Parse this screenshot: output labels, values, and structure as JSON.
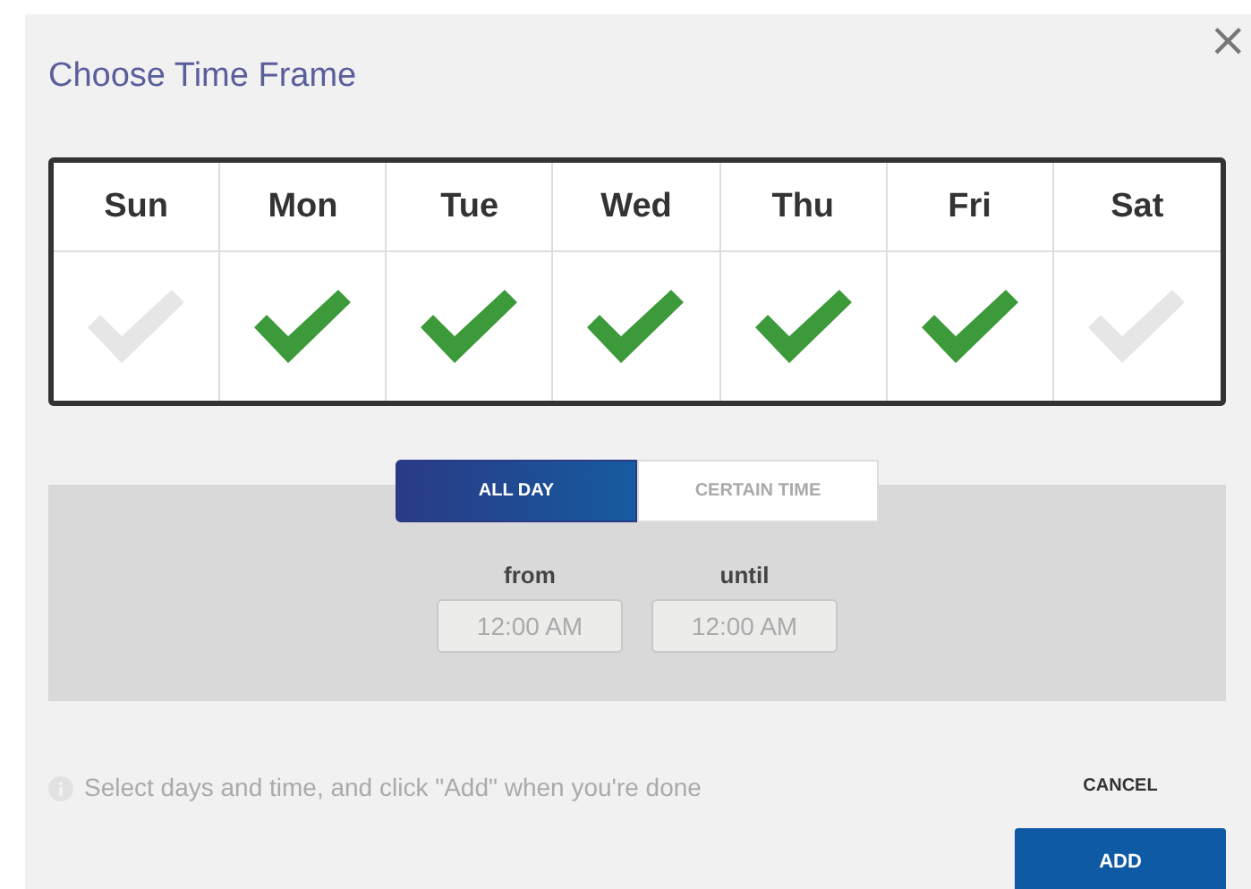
{
  "dialog": {
    "title": "Choose Time Frame",
    "close": "×"
  },
  "days": [
    {
      "label": "Sun",
      "checked": false
    },
    {
      "label": "Mon",
      "checked": true
    },
    {
      "label": "Tue",
      "checked": true
    },
    {
      "label": "Wed",
      "checked": true
    },
    {
      "label": "Thu",
      "checked": true
    },
    {
      "label": "Fri",
      "checked": true
    },
    {
      "label": "Sat",
      "checked": false
    }
  ],
  "modes": [
    {
      "label": "ALL DAY",
      "selected": true
    },
    {
      "label": "CERTAIN TIME",
      "selected": false
    }
  ],
  "time": {
    "from_label": "from",
    "from_value": "12:00 AM",
    "until_label": "until",
    "until_value": "12:00 AM",
    "disabled": true
  },
  "hint": "Select days and time, and click \"Add\" when you're done",
  "buttons": {
    "cancel": "CANCEL",
    "add": "ADD"
  }
}
